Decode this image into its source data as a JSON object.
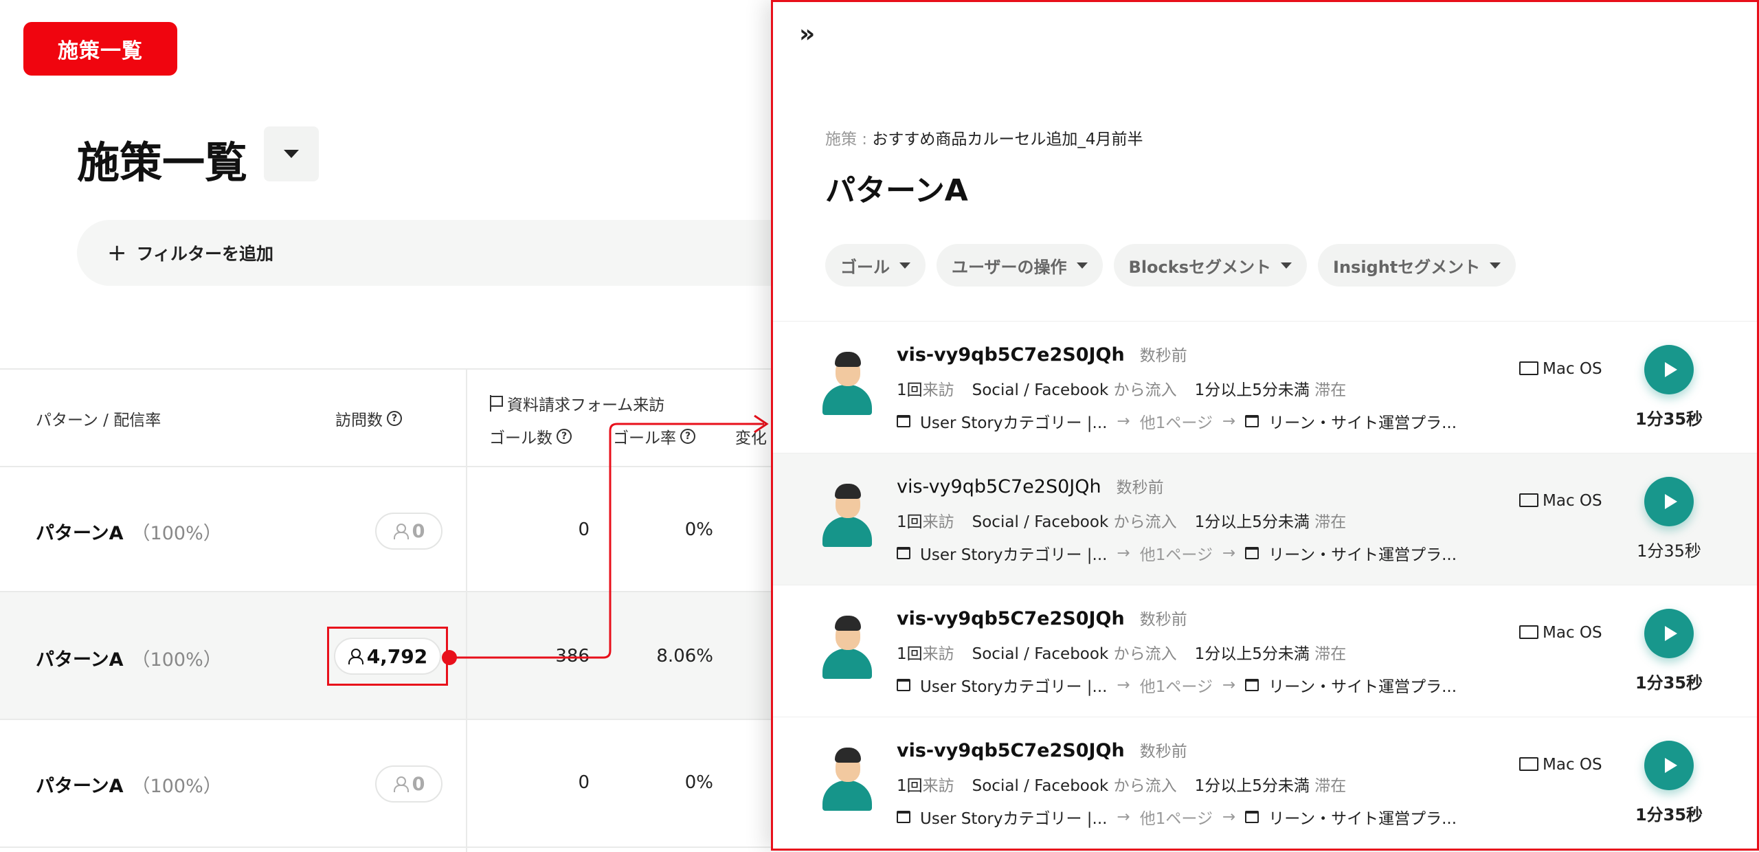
{
  "tag": "施策一覧",
  "page": {
    "title": "施策一覧",
    "filter_label": "フィルターを追加"
  },
  "table": {
    "headers": {
      "pattern": "パターン / 配信率",
      "visits": "訪問数",
      "goal_group": "資料請求フォーム来訪",
      "goal_count": "ゴール数",
      "goal_rate": "ゴール率",
      "change": "変化"
    },
    "rows": [
      {
        "name": "パターンA",
        "pct": "（100%）",
        "visits": "0",
        "goal_count": "0",
        "goal_rate": "0%"
      },
      {
        "name": "パターンA",
        "pct": "（100%）",
        "visits": "4,792",
        "goal_count": "386",
        "goal_rate": "8.06%"
      },
      {
        "name": "パターンA",
        "pct": "（100%）",
        "visits": "0",
        "goal_count": "0",
        "goal_rate": "0%"
      }
    ]
  },
  "panel": {
    "collapse_icon": "»",
    "measure_label": "施策 : ",
    "measure_value": "おすすめ商品カルーセル追加_4月前半",
    "title": "パターンA",
    "chips": [
      "ゴール",
      "ユーザーの操作",
      "Blocksセグメント",
      "Insightセグメント"
    ],
    "visitors": [
      {
        "id": "vis-vy9qb5C7e2S0JQh",
        "time": "数秒前",
        "visits_n": "1回",
        "visits_word": "来訪",
        "source": "Social / Facebook",
        "source_suffix": "から流入",
        "stay": "1分以上5分未満",
        "stay_suffix": "滞在",
        "page_from": "User Storyカテゴリー |...",
        "middle": "他1ページ",
        "page_to": "リーン・サイト運営プラ...",
        "os": "Mac OS",
        "duration": "1分35秒",
        "bold": true
      },
      {
        "id": "vis-vy9qb5C7e2S0JQh",
        "time": "数秒前",
        "visits_n": "1回",
        "visits_word": "来訪",
        "source": "Social / Facebook",
        "source_suffix": "から流入",
        "stay": "1分以上5分未満",
        "stay_suffix": "滞在",
        "page_from": "User Storyカテゴリー |...",
        "middle": "他1ページ",
        "page_to": "リーン・サイト運営プラ...",
        "os": "Mac OS",
        "duration": "1分35秒",
        "bold": false
      },
      {
        "id": "vis-vy9qb5C7e2S0JQh",
        "time": "数秒前",
        "visits_n": "1回",
        "visits_word": "来訪",
        "source": "Social / Facebook",
        "source_suffix": "から流入",
        "stay": "1分以上5分未満",
        "stay_suffix": "滞在",
        "page_from": "User Storyカテゴリー |...",
        "middle": "他1ページ",
        "page_to": "リーン・サイト運営プラ...",
        "os": "Mac OS",
        "duration": "1分35秒",
        "bold": true
      },
      {
        "id": "vis-vy9qb5C7e2S0JQh",
        "time": "数秒前",
        "visits_n": "1回",
        "visits_word": "来訪",
        "source": "Social / Facebook",
        "source_suffix": "から流入",
        "stay": "1分以上5分未満",
        "stay_suffix": "滞在",
        "page_from": "User Storyカテゴリー |...",
        "middle": "他1ページ",
        "page_to": "リーン・サイト運営プラ...",
        "os": "Mac OS",
        "duration": "1分35秒",
        "bold": true
      }
    ]
  },
  "colors": {
    "accent_red": "#e8101b",
    "play_teal": "#18978c"
  }
}
